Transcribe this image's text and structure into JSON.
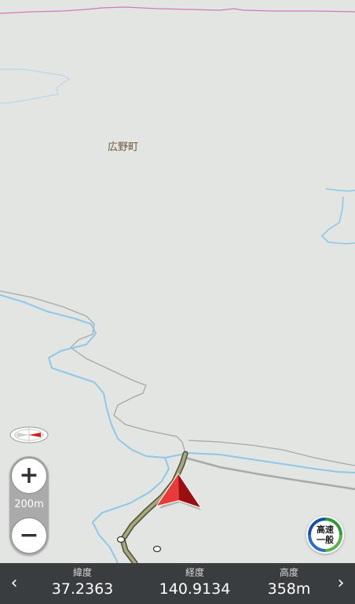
{
  "map": {
    "place_label": "広野町",
    "scale_label": "200m"
  },
  "controls": {
    "zoom_in_label": "+",
    "zoom_out_label": "−",
    "road_mode_line1": "高速",
    "road_mode_line2": "一般"
  },
  "status_bar": {
    "left_arrow": "‹",
    "right_arrow": "›",
    "latitude_label": "緯度",
    "latitude_value": "37.2363",
    "longitude_label": "経度",
    "longitude_value": "140.9134",
    "altitude_label": "高度",
    "altitude_value": "358m"
  },
  "colors": {
    "land": "#e3e5e3",
    "river": "#8ec8e8",
    "boundary": "#9e9e9e",
    "route": "#a8a878",
    "position_marker": "#cc1c1c",
    "prefecture_border": "#d27ab8",
    "bar_background": "#3a3d40"
  }
}
